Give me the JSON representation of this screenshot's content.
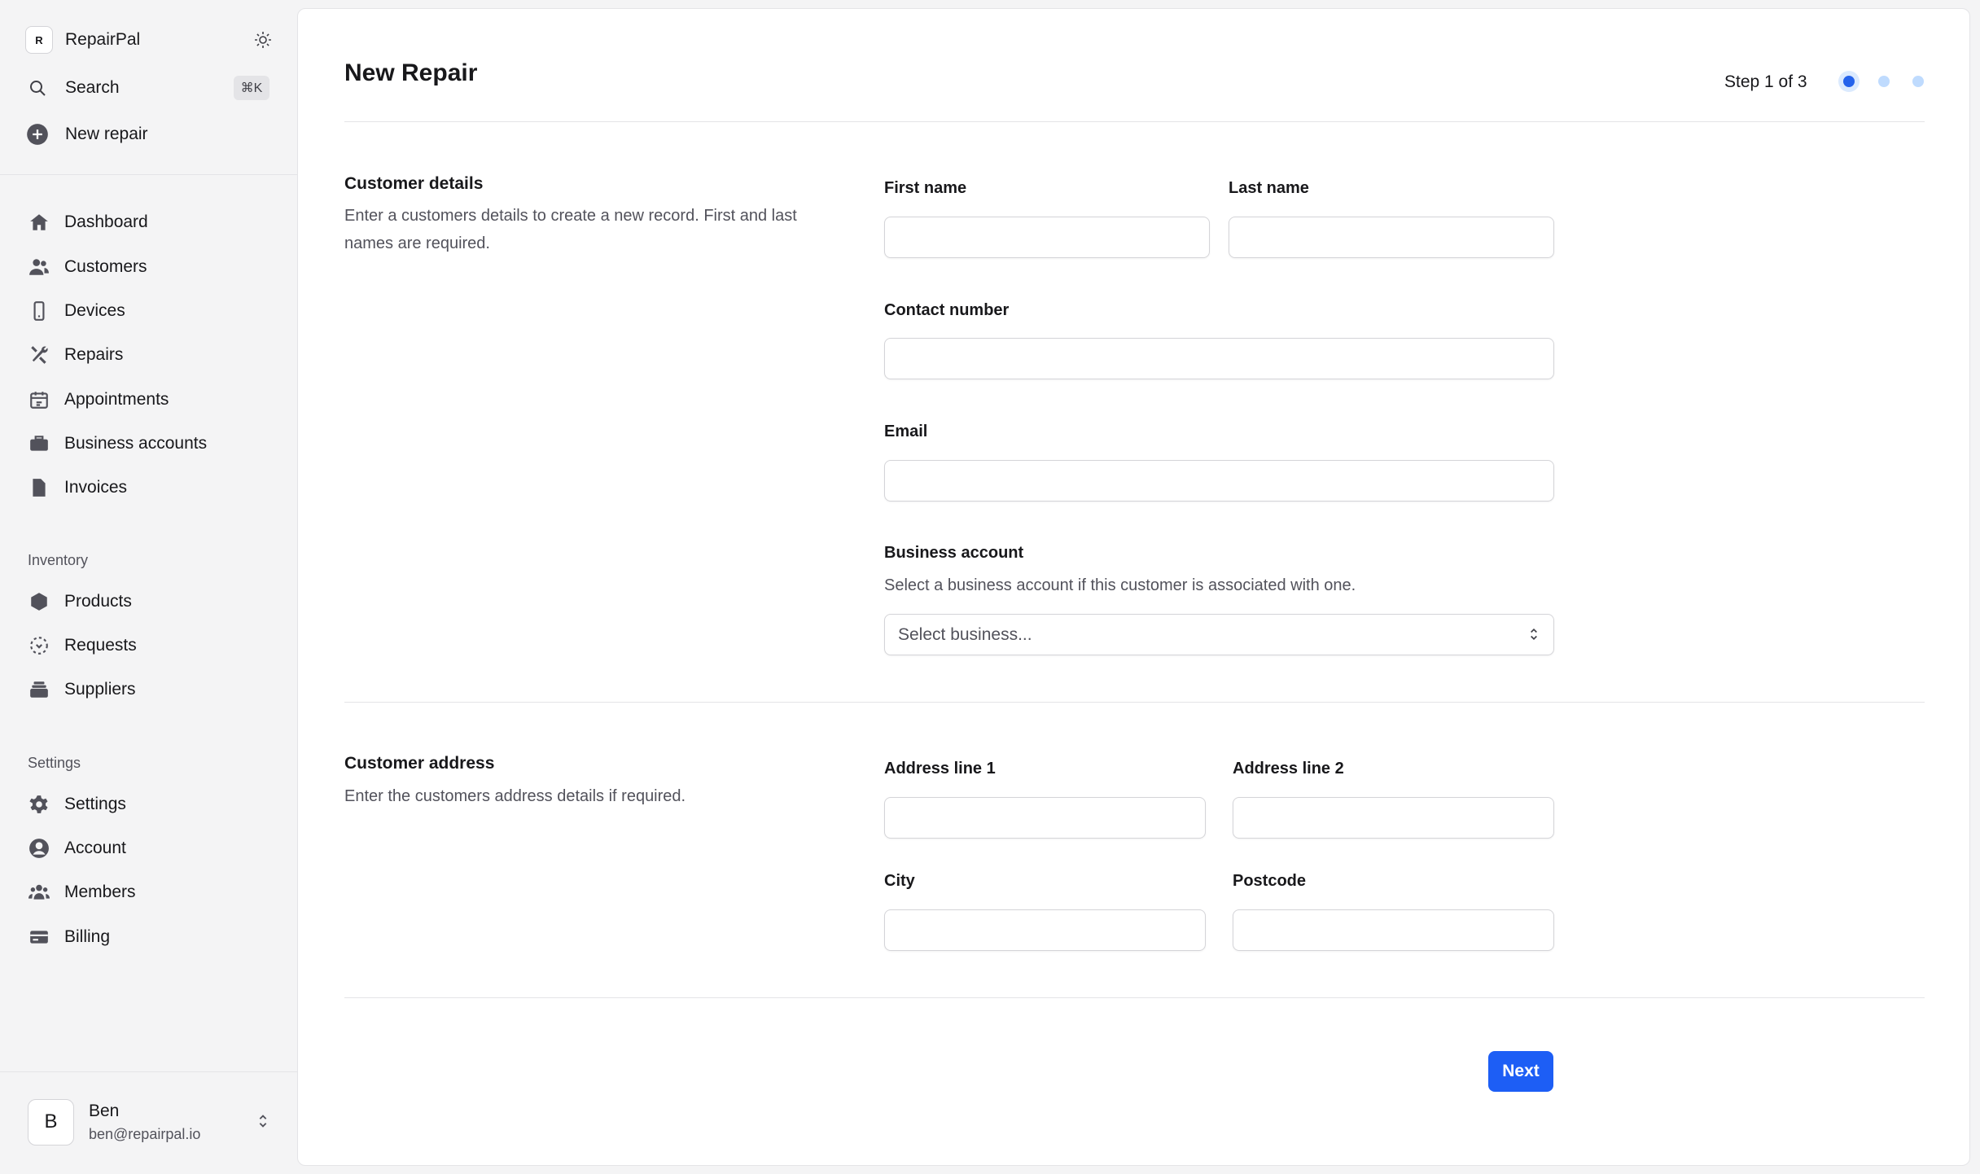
{
  "app": {
    "name": "RepairPal",
    "logo_letter": "R",
    "search_label": "Search",
    "search_shortcut": "⌘K",
    "new_repair_label": "New repair"
  },
  "sidebar": {
    "nav": [
      {
        "label": "Dashboard",
        "icon": "home-icon"
      },
      {
        "label": "Customers",
        "icon": "users-icon"
      },
      {
        "label": "Devices",
        "icon": "phone-icon"
      },
      {
        "label": "Repairs",
        "icon": "wrench-icon"
      },
      {
        "label": "Appointments",
        "icon": "calendar-icon"
      },
      {
        "label": "Business accounts",
        "icon": "briefcase-icon"
      },
      {
        "label": "Invoices",
        "icon": "document-icon"
      }
    ],
    "inventory_label": "Inventory",
    "inventory": [
      {
        "label": "Products",
        "icon": "cube-icon"
      },
      {
        "label": "Requests",
        "icon": "dashed-circle-icon"
      },
      {
        "label": "Suppliers",
        "icon": "stack-icon"
      }
    ],
    "settings_label": "Settings",
    "settings": [
      {
        "label": "Settings",
        "icon": "gear-icon"
      },
      {
        "label": "Account",
        "icon": "user-circle-icon"
      },
      {
        "label": "Members",
        "icon": "members-icon"
      },
      {
        "label": "Billing",
        "icon": "credit-card-icon"
      }
    ],
    "user": {
      "initial": "B",
      "name": "Ben",
      "email": "ben@repairpal.io"
    }
  },
  "page": {
    "title": "New Repair",
    "step_text": "Step 1 of 3",
    "current_step": 1,
    "total_steps": 3
  },
  "customer_details": {
    "title": "Customer details",
    "description": "Enter a customers details to create a new record. First and last names are required.",
    "first_name_label": "First name",
    "first_name_value": "",
    "last_name_label": "Last name",
    "last_name_value": "",
    "contact_label": "Contact number",
    "contact_value": "",
    "email_label": "Email",
    "email_value": "",
    "business_label": "Business account",
    "business_help": "Select a business account if this customer is associated with one.",
    "business_placeholder": "Select business..."
  },
  "customer_address": {
    "title": "Customer address",
    "description": "Enter the customers address details if required.",
    "address1_label": "Address line 1",
    "address1_value": "",
    "address2_label": "Address line 2",
    "address2_value": "",
    "city_label": "City",
    "city_value": "",
    "postcode_label": "Postcode",
    "postcode_value": ""
  },
  "actions": {
    "next_label": "Next"
  },
  "colors": {
    "accent": "#1d5ef5",
    "step_inactive": "#bfdbfe",
    "sidebar_bg": "#f4f4f5"
  }
}
